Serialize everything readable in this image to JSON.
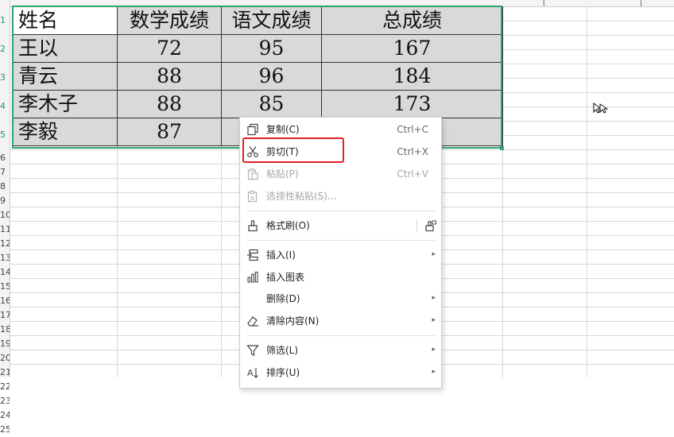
{
  "table": {
    "headers": [
      "姓名",
      "数学成绩",
      "语文成绩",
      "总成绩"
    ],
    "rows": [
      [
        "王以",
        "72",
        "95",
        "167"
      ],
      [
        "青云",
        "88",
        "96",
        "184"
      ],
      [
        "李木子",
        "88",
        "85",
        "173"
      ],
      [
        "李毅",
        "87",
        "",
        ""
      ]
    ]
  },
  "row_numbers": [
    "1",
    "2",
    "3",
    "4",
    "5",
    "6",
    "7",
    "8",
    "9",
    "10",
    "11",
    "12",
    "13",
    "14",
    "15",
    "16",
    "17",
    "18",
    "19",
    "20",
    "21",
    "22",
    "23",
    "24",
    "25"
  ],
  "context_menu": {
    "items": [
      {
        "label": "复制(C)",
        "shortcut": "Ctrl+C",
        "icon": "copy-icon"
      },
      {
        "label": "剪切(T)",
        "shortcut": "Ctrl+X",
        "icon": "scissors-icon"
      },
      {
        "label": "粘贴(P)",
        "shortcut": "Ctrl+V",
        "icon": "paste-icon"
      },
      {
        "label": "选择性粘贴(S)...",
        "icon": "paste-special-icon"
      },
      {
        "label": "格式刷(O)",
        "icon": "format-painter-icon"
      },
      {
        "label": "插入(I)",
        "icon": "insert-icon"
      },
      {
        "label": "插入图表",
        "icon": "chart-icon"
      },
      {
        "label": "删除(D)"
      },
      {
        "label": "清除内容(N)",
        "icon": "eraser-icon"
      },
      {
        "label": "筛选(L)",
        "icon": "filter-icon"
      },
      {
        "label": "排序(U)",
        "icon": "sort-icon"
      }
    ]
  },
  "colors": {
    "selection": "#2fa36f",
    "highlight": "#e02020",
    "cell_fill": "#d9d9d9"
  }
}
